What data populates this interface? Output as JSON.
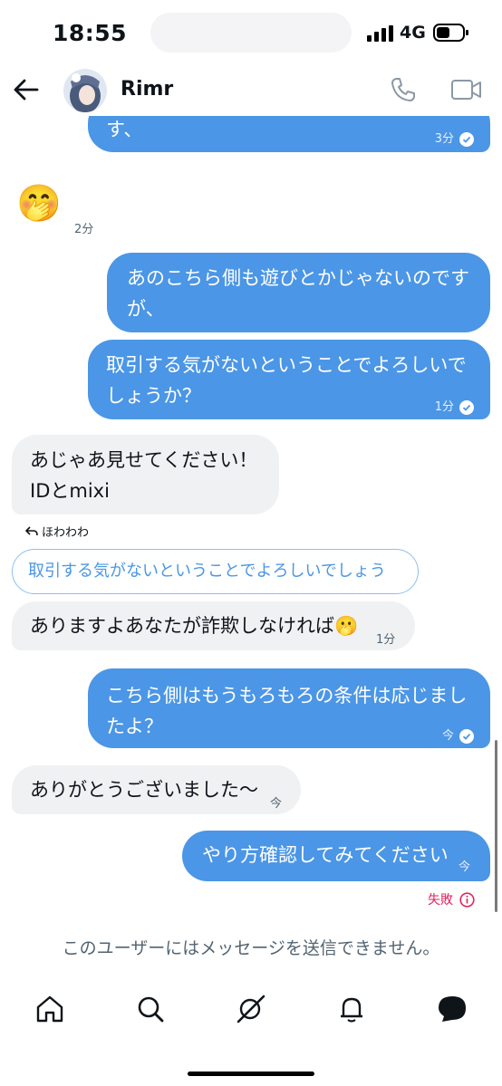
{
  "status_bar": {
    "time": "18:55",
    "network": "4G"
  },
  "header": {
    "contact_name": "Rimr"
  },
  "messages": [
    {
      "type": "sent",
      "text": "す、",
      "time": "3分"
    },
    {
      "type": "received-emoji",
      "emoji": "🤭",
      "time": "2分"
    },
    {
      "type": "sent",
      "text_lines": [
        "あのこちら側も遊びとかじゃないのです",
        "が、"
      ]
    },
    {
      "type": "sent",
      "text_lines": [
        "取引する気がないということでよろしいで",
        "しょうか？"
      ],
      "time": "1分"
    },
    {
      "type": "received",
      "text_lines": [
        "あじゃあ見せてください！",
        "IDとmixi"
      ]
    },
    {
      "type": "received",
      "text": "ありますよあなたが詐欺しなければ🫢",
      "time": "1分"
    },
    {
      "type": "sent",
      "text_lines": [
        "こちら側はもうもろもろの条件は応じまし",
        "たよ？"
      ],
      "time": "今"
    },
    {
      "type": "received",
      "text": "ありがとうございました〜",
      "time": "今"
    },
    {
      "type": "sent",
      "text": "やり方確認してみてください",
      "time": "今",
      "status": "失敗"
    }
  ],
  "reply": {
    "replied_by": "ほわわわ",
    "quoted_text": "取引する気がないということでよろしいでしょうか？"
  },
  "notice": "このユーザーにはメッセージを送信できません。",
  "colors": {
    "sent_bubble": "#4b96e6",
    "received_bubble": "#eff1f3",
    "failed": "#e0245e",
    "link_blue": "#4b96e6"
  },
  "nav": {
    "items": [
      "home-icon",
      "search-icon",
      "grok-icon",
      "notifications-icon",
      "messages-icon"
    ]
  }
}
